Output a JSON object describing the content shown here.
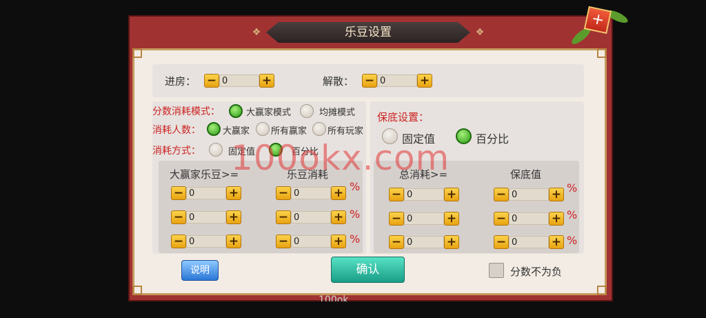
{
  "dialog": {
    "title": "乐豆设置",
    "close_glyph": "+"
  },
  "room": {
    "enter_label": "进房：",
    "enter_value": "0",
    "dissolve_label": "解散：",
    "dissolve_value": "0"
  },
  "score_mode": {
    "label": "分数消耗模式：",
    "options": [
      "大赢家模式",
      "均摊模式"
    ],
    "selected": "大赢家模式"
  },
  "consume_count": {
    "label": "消耗人数：",
    "options": [
      "大赢家",
      "所有赢家",
      "所有玩家"
    ],
    "selected": "大赢家"
  },
  "consume_method": {
    "label": "消耗方式：",
    "options": [
      "固定值",
      "百分比"
    ],
    "selected": "百分比"
  },
  "guarantee": {
    "label": "保底设置：",
    "options": [
      "固定值",
      "百分比"
    ],
    "selected": "百分比"
  },
  "left_table": {
    "headers": [
      "大赢家乐豆>=",
      "乐豆消耗"
    ],
    "rows": [
      [
        "0",
        "0"
      ],
      [
        "0",
        "0"
      ],
      [
        "0",
        "0"
      ]
    ],
    "unit": "%"
  },
  "right_table": {
    "headers": [
      "总消耗>=",
      "保底值"
    ],
    "rows": [
      [
        "0",
        "0"
      ],
      [
        "0",
        "0"
      ],
      [
        "0",
        "0"
      ]
    ],
    "unit": "%"
  },
  "stepper": {
    "minus": "−",
    "plus": "+"
  },
  "footer": {
    "help_label": "说明",
    "confirm_label": "确认",
    "nonneg_label": "分数不为负",
    "nonneg_checked": false
  },
  "bottom_text": "100ok",
  "watermark": "100okx.com",
  "colors": {
    "frame": "#a13232",
    "accent_green": "#2b9a16",
    "confirm": "#1a9d87",
    "help": "#2a77d6",
    "red_text": "#cc2222"
  }
}
